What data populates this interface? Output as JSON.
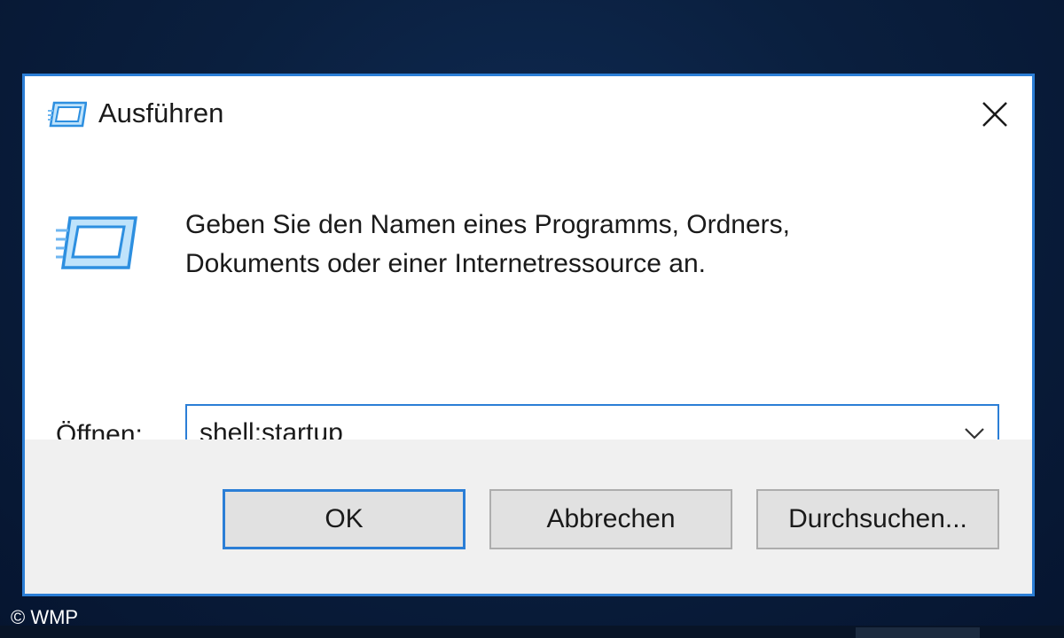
{
  "dialog": {
    "title": "Ausführen",
    "title_icon": "run-icon",
    "close_icon": "close-icon",
    "description_line1": "Geben Sie den Namen eines Programms, Ordners,",
    "description_line2": "Dokuments oder einer Internetressource an.",
    "content_icon": "run-icon",
    "open_label": "Öffnen:",
    "open_value": "shell:startup",
    "dropdown_icon": "chevron-down-icon",
    "buttons": {
      "ok": "OK",
      "cancel": "Abbrechen",
      "browse": "Durchsuchen..."
    }
  },
  "watermark": "© WMP",
  "colors": {
    "accent": "#2b7ed6",
    "desktop": "#0a1f3e",
    "footer": "#f0f0f0",
    "button": "#e1e1e1"
  }
}
